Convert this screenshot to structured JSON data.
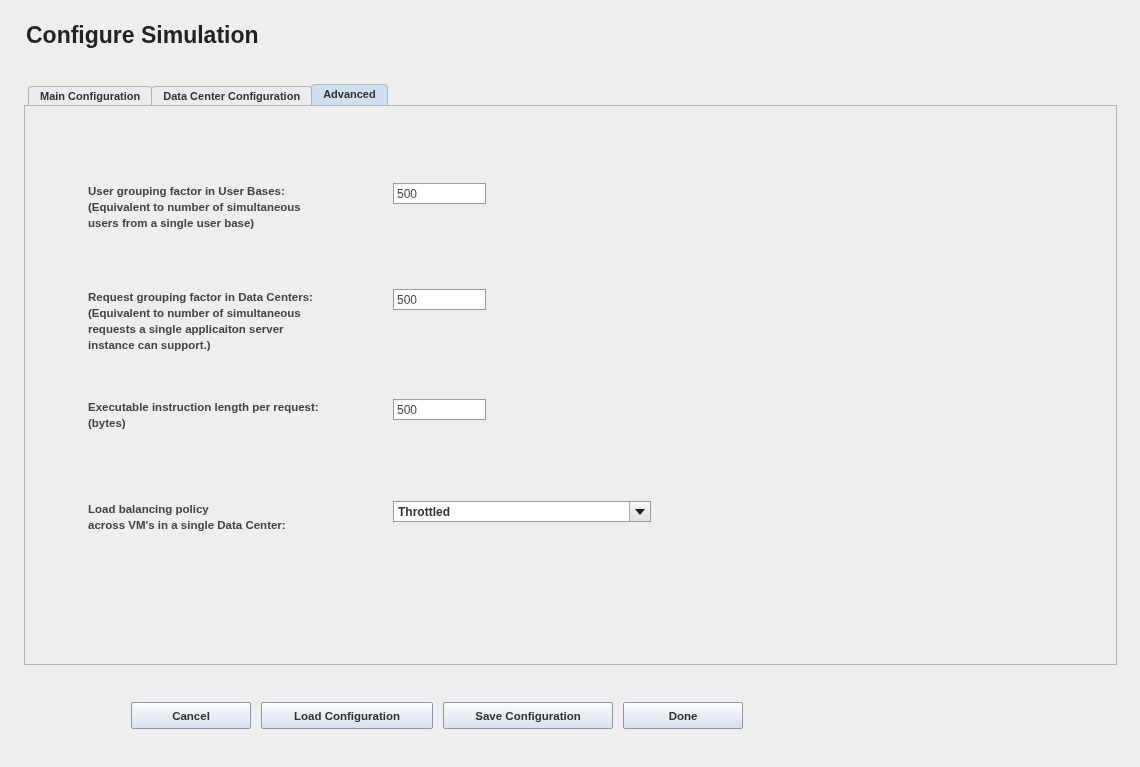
{
  "window": {
    "title": "Configure Simulation"
  },
  "tabs": [
    {
      "label": "Main Configuration",
      "selected": false
    },
    {
      "label": "Data Center Configuration",
      "selected": false
    },
    {
      "label": "Advanced",
      "selected": true
    }
  ],
  "settings": [
    {
      "kind": "text",
      "label_lines": [
        "User grouping factor in User Bases:",
        "(Equivalent to number of simultaneous",
        "users from a single user base)"
      ],
      "value": "500"
    },
    {
      "kind": "text",
      "label_lines": [
        "Request grouping factor in Data Centers:",
        "(Equivalent to number of simultaneous",
        "requests a single applicaiton server",
        "instance can support.)"
      ],
      "value": "500"
    },
    {
      "kind": "text",
      "label_lines": [
        "Executable instruction length per request:",
        "(bytes)"
      ],
      "value": "500"
    },
    {
      "kind": "dropdown",
      "label_lines": [
        "Load balancing policy",
        "across VM's in a single Data Center:"
      ],
      "value": "Throttled"
    }
  ],
  "buttons": [
    "Cancel",
    "Load Configuration",
    "Save Configuration",
    "Done"
  ]
}
